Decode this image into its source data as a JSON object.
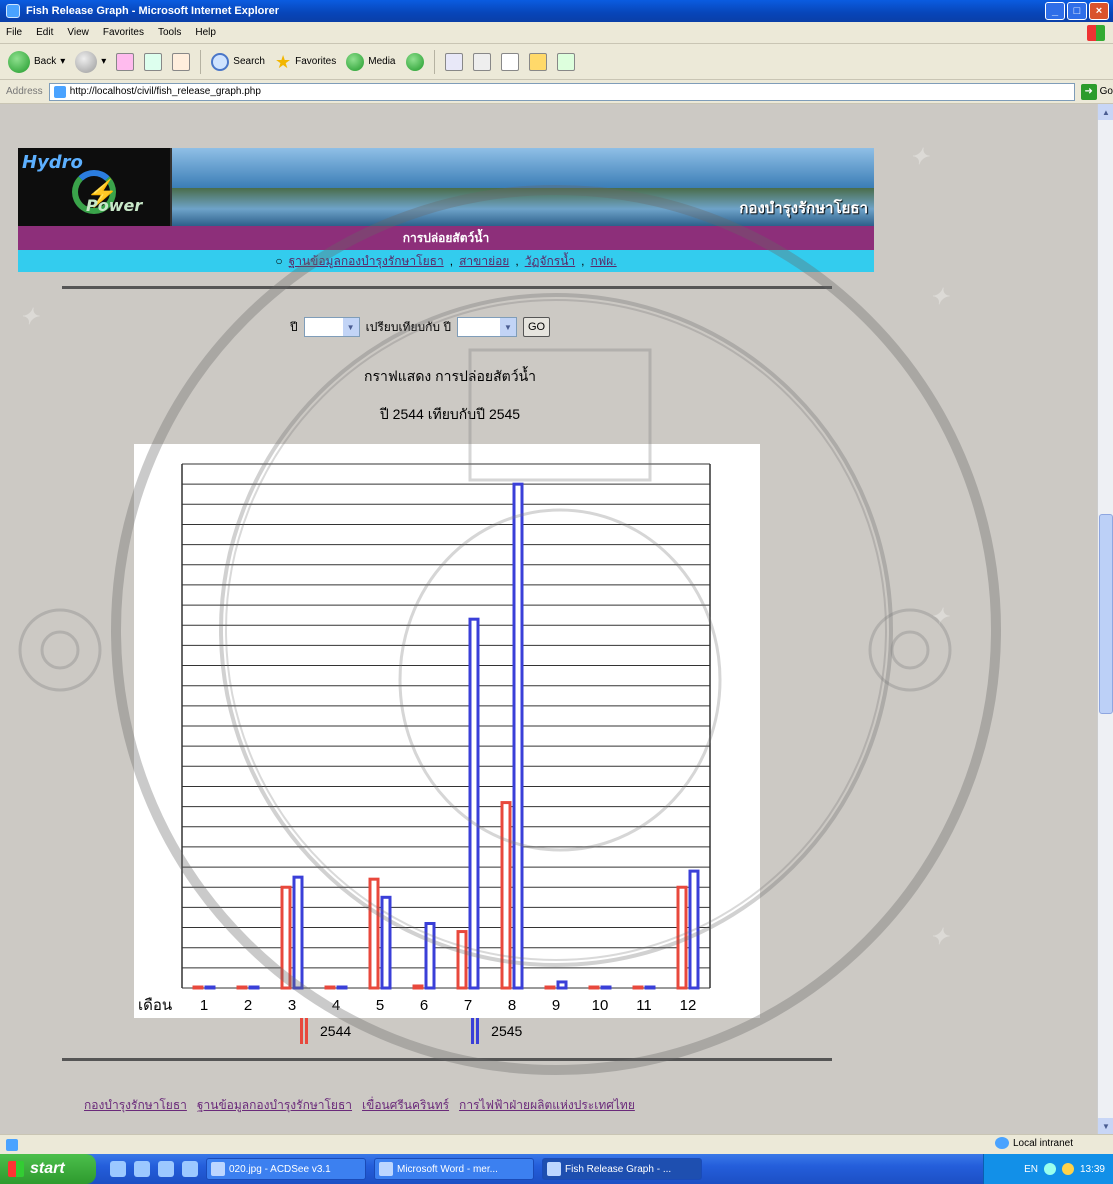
{
  "window": {
    "title": "Fish Release Graph - Microsoft Internet Explorer",
    "min": "_",
    "max": "□",
    "close": "×"
  },
  "menu": [
    "File",
    "Edit",
    "View",
    "Favorites",
    "Tools",
    "Help"
  ],
  "toolbar": {
    "back": "Back",
    "search": "Search",
    "favorites": "Favorites",
    "media": "Media"
  },
  "address": {
    "label": "Address",
    "url": "http://localhost/civil/fish_release_graph.php",
    "go": "Go"
  },
  "banner": {
    "logo_top": "Hydro",
    "logo_bottom": "Power",
    "org": "กองบำรุงรักษาโยธา",
    "section": "การปล่อยสัตว์น้ำ",
    "nav_links": [
      "ฐานข้อมูลกองบำรุงรักษาโยธา",
      "สาขาย่อย",
      "วัฏจักรน้ำ",
      "กฟผ."
    ]
  },
  "form": {
    "year_label": "ปี",
    "compare_label": "เปรียบเทียบกับ ปี",
    "go_label": "GO"
  },
  "headings": {
    "title": "กราฟแสดง การปล่อยสัตว์น้ำ",
    "subtitle": "ปี 2544 เทียบกับปี 2545"
  },
  "chart_data": {
    "type": "bar",
    "xlabel": "เดือน",
    "categories": [
      "1",
      "2",
      "3",
      "4",
      "5",
      "6",
      "7",
      "8",
      "9",
      "10",
      "11",
      "12"
    ],
    "series": [
      {
        "name": "2544",
        "values": [
          0,
          0,
          500000,
          0,
          540000,
          10000,
          280000,
          920000,
          0,
          0,
          0,
          500000
        ]
      },
      {
        "name": "2545",
        "values": [
          0,
          0,
          550000,
          0,
          450000,
          320000,
          1830000,
          2500000,
          30000,
          0,
          0,
          580000
        ]
      }
    ],
    "ylim": [
      0,
      2600000
    ],
    "gridlines": true,
    "colors": {
      "2544": "#e8483c",
      "2545": "#3a3fd8"
    }
  },
  "footer_links": [
    "กองบำรุงรักษาโยธา",
    "ฐานข้อมูลกองบำรุงรักษาโยธา",
    "เขื่อนศรีนครินทร์",
    "การไฟฟ้าฝ่ายผลิตแห่งประเทศไทย"
  ],
  "status": {
    "zone": "Local intranet"
  },
  "taskbar": {
    "start": "start",
    "tasks": [
      "020.jpg - ACDSee v3.1",
      "Microsoft Word - mer...",
      "Fish Release Graph - ..."
    ],
    "lang": "EN",
    "clock": "13:39"
  }
}
